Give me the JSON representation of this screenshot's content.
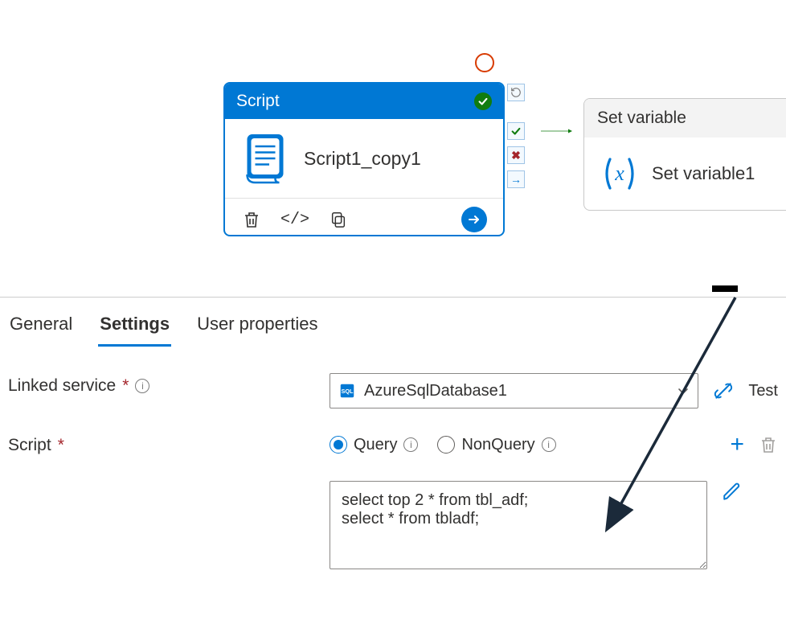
{
  "canvas": {
    "script_node": {
      "header_label": "Script",
      "name": "Script1_copy1"
    },
    "setvar_node": {
      "header_label": "Set variable",
      "name": "Set variable1"
    }
  },
  "tabs": {
    "general": "General",
    "settings": "Settings",
    "user_properties": "User properties"
  },
  "form": {
    "linked_service_label": "Linked service",
    "linked_service_value": "AzureSqlDatabase1",
    "test_label": "Test",
    "script_label": "Script",
    "radio_query": "Query",
    "radio_nonquery": "NonQuery",
    "script_text": "select top 2 * from tbl_adf;\nselect * from tbladf;"
  }
}
